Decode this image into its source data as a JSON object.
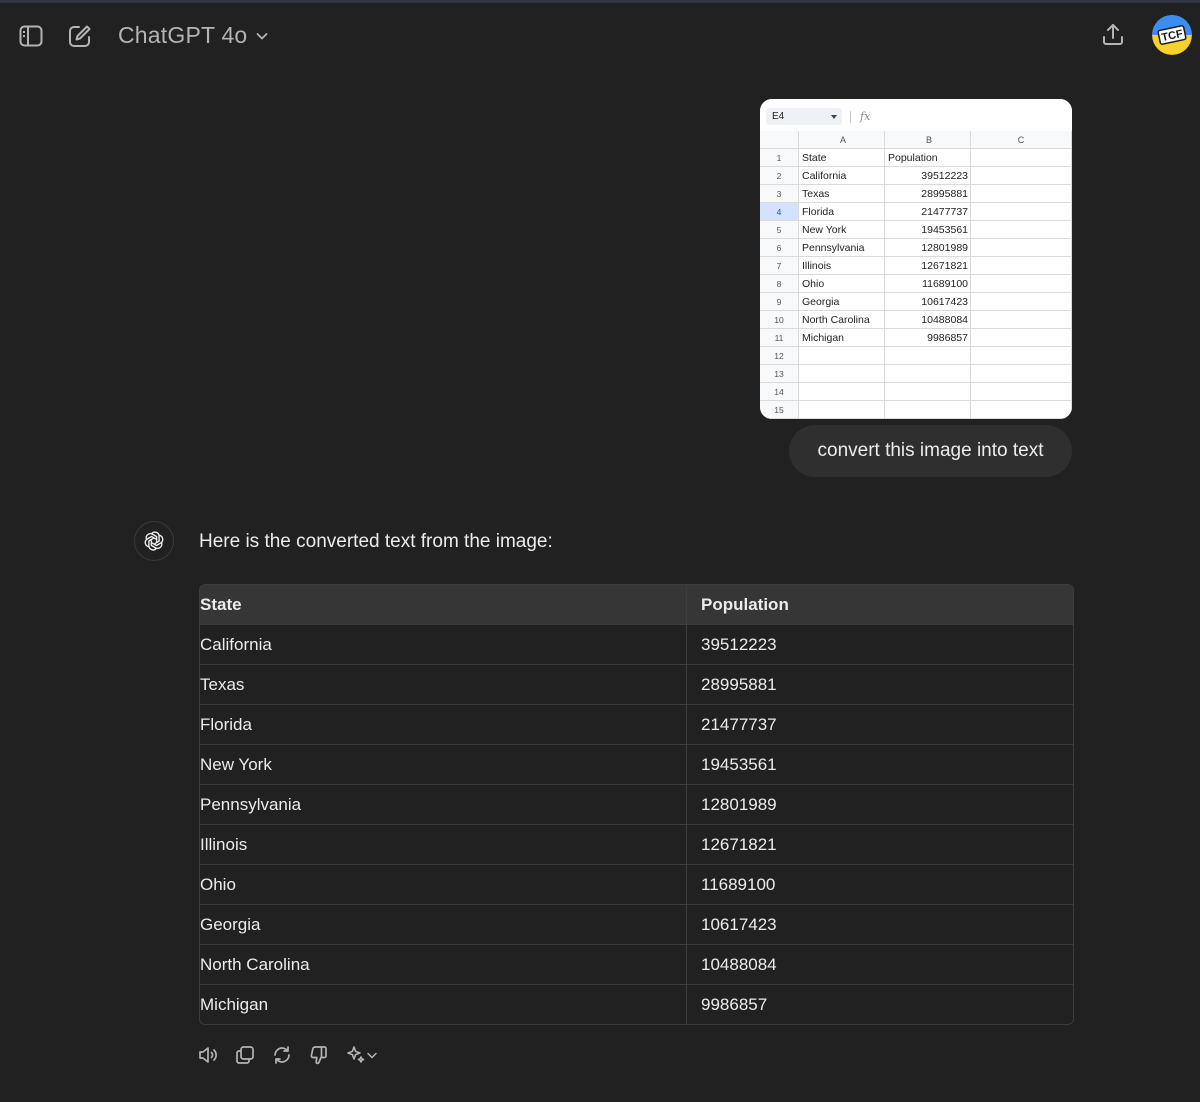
{
  "header": {
    "model_name": "ChatGPT 4o",
    "icons": {
      "sidebar": "sidebar-toggle-icon",
      "new_chat": "new-chat-icon",
      "share": "share-icon",
      "model_dropdown": "chevron-down-icon"
    },
    "avatar_text": "TCF"
  },
  "user_message": {
    "text": "convert this image into text",
    "image": {
      "name_box": "E4",
      "formula_icon": "fx",
      "column_headers": [
        "A",
        "B",
        "C"
      ],
      "rows": [
        {
          "n": "1",
          "a": "State",
          "b": "Population"
        },
        {
          "n": "2",
          "a": "California",
          "b": "39512223"
        },
        {
          "n": "3",
          "a": "Texas",
          "b": "28995881"
        },
        {
          "n": "4",
          "a": "Florida",
          "b": "21477737"
        },
        {
          "n": "5",
          "a": "New York",
          "b": "19453561"
        },
        {
          "n": "6",
          "a": "Pennsylvania",
          "b": "12801989"
        },
        {
          "n": "7",
          "a": "Illinois",
          "b": "12671821"
        },
        {
          "n": "8",
          "a": "Ohio",
          "b": "11689100"
        },
        {
          "n": "9",
          "a": "Georgia",
          "b": "10617423"
        },
        {
          "n": "10",
          "a": "North Carolina",
          "b": "10488084"
        },
        {
          "n": "11",
          "a": "Michigan",
          "b": "9986857"
        },
        {
          "n": "12",
          "a": "",
          "b": ""
        },
        {
          "n": "13",
          "a": "",
          "b": ""
        },
        {
          "n": "14",
          "a": "",
          "b": ""
        },
        {
          "n": "15",
          "a": "",
          "b": ""
        }
      ]
    }
  },
  "assistant_message": {
    "intro": "Here is the converted text from the image:",
    "table": {
      "headers": [
        "State",
        "Population"
      ],
      "rows": [
        [
          "California",
          "39512223"
        ],
        [
          "Texas",
          "28995881"
        ],
        [
          "Florida",
          "21477737"
        ],
        [
          "New York",
          "19453561"
        ],
        [
          "Pennsylvania",
          "12801989"
        ],
        [
          "Illinois",
          "12671821"
        ],
        [
          "Ohio",
          "11689100"
        ],
        [
          "Georgia",
          "10617423"
        ],
        [
          "North Carolina",
          "10488084"
        ],
        [
          "Michigan",
          "9986857"
        ]
      ]
    },
    "actions": [
      "read-aloud-icon",
      "copy-icon",
      "regenerate-icon",
      "thumbs-down-icon",
      "sparkle-icon",
      "chevron-down-icon"
    ]
  },
  "colors": {
    "background": "#212121",
    "user_bubble": "#2f2f2f",
    "table_header": "#363636",
    "border": "#3d3d3d",
    "text": "#ececec"
  }
}
